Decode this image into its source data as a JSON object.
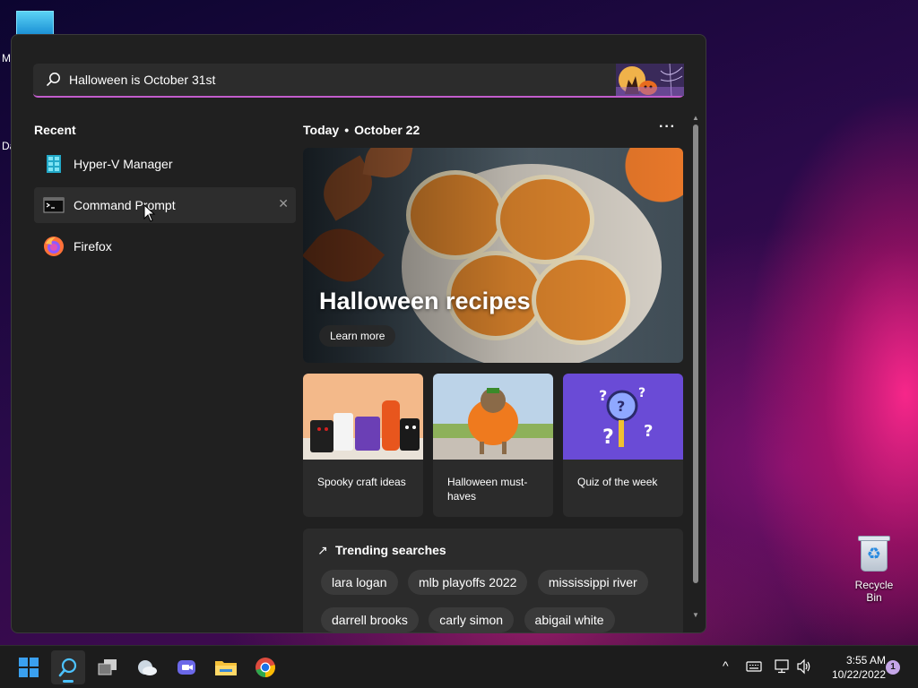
{
  "desktop": {
    "letters": [
      "M",
      "Da"
    ],
    "recycle_bin_label": "Recycle Bin"
  },
  "search": {
    "value": "Halloween is October 31st",
    "accent": "#c35dcd"
  },
  "recent": {
    "title": "Recent",
    "items": [
      {
        "label": "Hyper-V Manager",
        "icon": "hyper-v-icon"
      },
      {
        "label": "Command Prompt",
        "icon": "terminal-icon"
      },
      {
        "label": "Firefox",
        "icon": "firefox-icon"
      }
    ],
    "remove_glyph": "✕"
  },
  "today": {
    "label": "Today",
    "separator": "•",
    "date": "October 22",
    "more_glyph": "···"
  },
  "hero": {
    "title": "Halloween recipes",
    "button": "Learn more"
  },
  "cards": [
    {
      "caption": "Spooky craft ideas"
    },
    {
      "caption": "Halloween must-haves"
    },
    {
      "caption": "Quiz of the week"
    }
  ],
  "trending": {
    "title": "Trending searches",
    "icon_glyph": "↗",
    "chips": [
      "lara logan",
      "mlb playoffs 2022",
      "mississippi river",
      "darrell brooks",
      "carly simon",
      "abigail white"
    ]
  },
  "scrollbar": {
    "up_glyph": "▲",
    "down_glyph": "▼"
  },
  "taskbar": {
    "apps": [
      "start-icon",
      "search-icon",
      "task-view-icon",
      "weather-icon",
      "teams-chat-icon",
      "file-explorer-icon",
      "chrome-icon"
    ],
    "tray": {
      "chevron": "^",
      "time": "3:55 AM",
      "date": "10/22/2022",
      "notifications": "1"
    }
  }
}
